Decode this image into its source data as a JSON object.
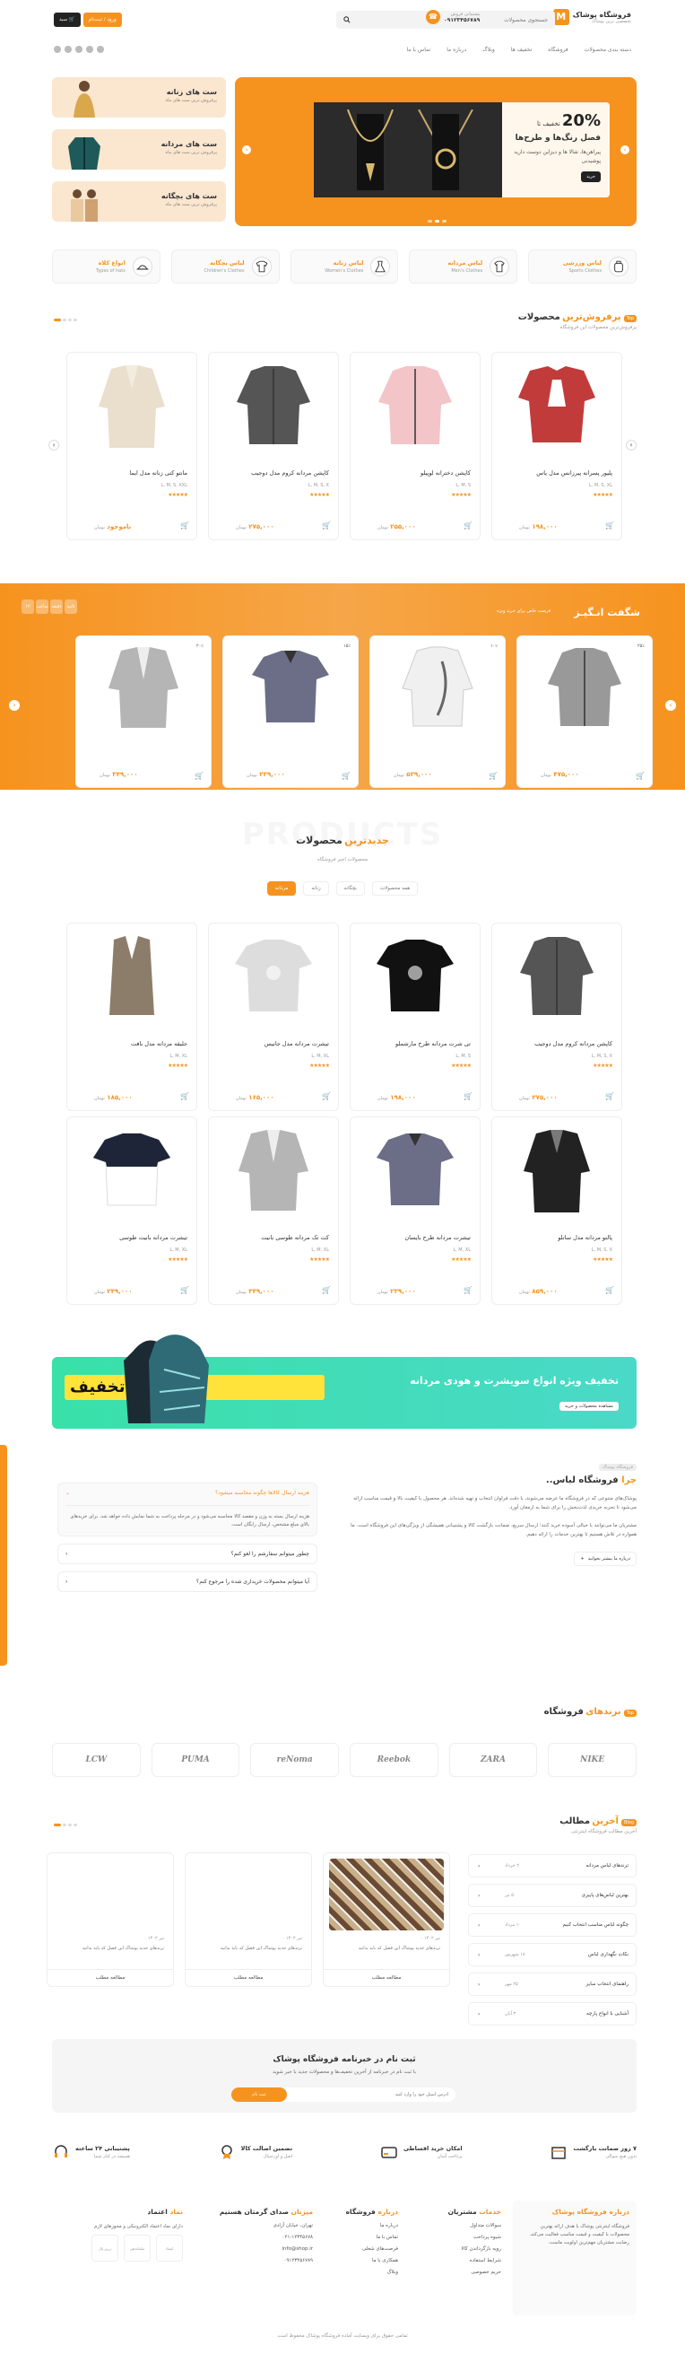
{
  "header": {
    "logo_title": "فروشگاه پوشاک",
    "logo_sub": "تخصصی ترین پوشاک",
    "search_placeholder": "جستجوی محصولات",
    "support_label": "پشتیبانی فروش",
    "support_phone": "۰۹۱۲۳۴۵۶۷۸۹",
    "login_label": "ورود / ثبت‌نام",
    "cart_label": "سبد",
    "nav": [
      "دسته بندی محصولات",
      "فروشگاه",
      "تخفیف ها",
      "وبلاگ",
      "درباره ما",
      "تماس با ما"
    ]
  },
  "hero": {
    "pct": "20%",
    "pct_pre": "تخفیف تا",
    "title": "فصل رنگ‌ها و طرح‌ها",
    "sub": "پیراهن‌ها، شالا ها و دیزاین دوست دارید پوشیدنی",
    "btn": "خرید"
  },
  "side_banners": [
    {
      "title": "ست های زنانه",
      "sub": "پرفروش ترین ست های ماه"
    },
    {
      "title": "ست های مردانه",
      "sub": "پرفروش ترین ست های ماه"
    },
    {
      "title": "ست های بچگانه",
      "sub": "پرفروش ترین ست های ماه"
    }
  ],
  "categories": [
    {
      "title": "لباس ورزشی",
      "sub": "Sports Clothes",
      "icon": "backpack-icon"
    },
    {
      "title": "لباس مردانه",
      "sub": "Men's Clothes",
      "icon": "shirt-icon"
    },
    {
      "title": "لباس زنانه",
      "sub": "Women's Clothes",
      "icon": "dress-icon"
    },
    {
      "title": "لباس بچگانه",
      "sub": "Children's Clothes",
      "icon": "tshirt-icon"
    },
    {
      "title": "انواع کلاه",
      "sub": "Types of hats",
      "icon": "hat-icon"
    }
  ],
  "bestseller": {
    "tag": "Top",
    "title_a": "پرفروش‌ترین",
    "title_b": "محصولات",
    "sub": "پرفروش‌ترین محصولات این فروشگاه",
    "items": [
      {
        "name": "پلیور پسرانه پیرزانس مدل یاس",
        "sizes": "L, M, S, XL",
        "price": "۱۹۸,۰۰۰",
        "old": "۲۳۰,۰۰۰",
        "color": "#c23b3b",
        "kind": "sweater"
      },
      {
        "name": "کاپشن دخترانه لوپیلو",
        "sizes": "L, M, S",
        "price": "۲۵۵,۰۰۰",
        "old": "",
        "color": "#f3c4c8",
        "kind": "jacket"
      },
      {
        "name": "کاپشن مردانه کروم مدل دوجیب",
        "sizes": "L, M, S, X",
        "price": "۲۷۵,۰۰۰",
        "old": "",
        "color": "#555",
        "kind": "jacket"
      },
      {
        "name": "مانتو کتی زنانه مدل ایما",
        "sizes": "L, M, S, XXL",
        "price": "ناموجود",
        "old": "",
        "color": "#eadfcc",
        "kind": "coat"
      }
    ]
  },
  "amazing": {
    "title": "شگفت انـگیـز",
    "sub": "فرصت خاص برای خرید ویژه",
    "timer": [
      "۱۲",
      "ساعت",
      "دقیقه",
      "ثانیه"
    ],
    "items": [
      {
        "price": "۴۷۵,۰۰۰",
        "color": "#999",
        "kind": "jacket",
        "badge": "۲۵٪"
      },
      {
        "price": "۵۳۹,۰۰۰",
        "color": "#f0f0f0",
        "kind": "shirt",
        "badge": "۱۰٪"
      },
      {
        "price": "۲۳۹,۰۰۰",
        "color": "#6b6e86",
        "kind": "polo",
        "badge": "۱۵٪"
      },
      {
        "price": "۳۴۹,۰۰۰",
        "color": "#b5b5b5",
        "kind": "blazer",
        "badge": "۲۰٪"
      }
    ]
  },
  "newest": {
    "bg_word": "PRODUCTS",
    "title_a": "جدیدترین",
    "title_b": "محصولات",
    "sub": "محصولات اخیر فروشگاه",
    "tabs": [
      "مردانه",
      "زنانه",
      "بچگانه",
      "همه محصولات"
    ],
    "row1": [
      {
        "name": "کاپشن مردانه کروم مدل دوجیب",
        "sizes": "L, M, S, X",
        "price": "۲۷۵,۰۰۰",
        "color": "#555",
        "kind": "jacket"
      },
      {
        "name": "تی شرت مردانه طرح مارشملو",
        "sizes": "L, M, S",
        "price": "۱۹۸,۰۰۰",
        "color": "#111",
        "kind": "tshirt"
      },
      {
        "name": "تیشرت مردانه مدل جانیس",
        "sizes": "L, M, XL",
        "price": "۱۶۵,۰۰۰",
        "color": "#ddd",
        "kind": "tshirt"
      },
      {
        "name": "جلیقه مردانه مدل بافت",
        "sizes": "L, M, XL",
        "price": "۱۸۵,۰۰۰",
        "color": "#8c7d6a",
        "kind": "vest"
      }
    ],
    "row2": [
      {
        "name": "پالتو مردانه مدل ساتلو",
        "sizes": "L, M, S, X",
        "price": "۸۵۹,۰۰۰",
        "color": "#222",
        "kind": "coat"
      },
      {
        "name": "تیشرت مردانه طرح بایسان",
        "sizes": "L, M, XL",
        "price": "۲۳۹,۰۰۰",
        "color": "#6b6e86",
        "kind": "polo"
      },
      {
        "name": "کت تک مردانه طوسی بانیت",
        "sizes": "L, M, XL",
        "price": "۳۴۹,۰۰۰",
        "color": "#b5b5b5",
        "kind": "blazer"
      },
      {
        "name": "تیشرت مردانه بانیت طوسی",
        "sizes": "L, M, XL",
        "price": "۲۴۹,۰۰۰",
        "color": "#1f2538",
        "kind": "tshirt2"
      }
    ]
  },
  "green_banner": {
    "title": "تخفیف ویژه انواع سویشرت و هودی مردانه",
    "btn": "مشاهده محصولات و خرید",
    "pct": "۲۵٪ تخفیف"
  },
  "about": {
    "tag": "فروشگاه پوشاک",
    "title_a": "چرا",
    "title_b": "فروشگاه لباس..",
    "p1": "پوشاک‌های متنوعی که در فروشگاه ما عرضه می‌شوند، با دقت فراوان انتخاب و تهیه شده‌اند. هر محصول با کیفیت بالا و قیمت مناسب ارائه می‌شود تا تجربه خریدی لذت‌بخش را برای شما به ارمغان آورد.",
    "p2": "مشتریان ما می‌توانند با خیالی آسوده خرید کنند؛ ارسال سریع، ضمانت بازگشت کالا و پشتیبانی همیشگی از ویژگی‌های این فروشگاه است. ما همواره در تلاش هستیم تا بهترین خدمات را ارائه دهیم.",
    "btn": "درباره ما بیشتر بخوانید"
  },
  "faq": [
    {
      "q": "هزینه ارسال کالاها چگونه محاسبه میشود؟",
      "a": "هزینه ارسال بسته به وزن و مقصد کالا محاسبه می‌شود و در مرحله پرداخت به شما نمایش داده خواهد شد. برای خریدهای بالای مبلغ مشخص، ارسال رایگان است."
    },
    {
      "q": "چطور میتوانم سفارشم را لغو کنم؟",
      "a": ""
    },
    {
      "q": "آیا میتوانم محصولات خریداری شده را مرجوع کنم؟",
      "a": ""
    }
  ],
  "brands": {
    "title_a": "برندهای",
    "title_b": "فروشگاه",
    "tag": "Top",
    "items": [
      "NIKE",
      "ZARA",
      "Reebok",
      "reNoma",
      "PUMA",
      "LCW"
    ]
  },
  "blog": {
    "tag": "Blog",
    "title_a": "آخرین",
    "title_b": "مطالب",
    "sub": "آخرین مطالب فروشگاه اینترنتی",
    "list": [
      {
        "t": "ترندهای لباس مردانه",
        "d": "۲ خرداد"
      },
      {
        "t": "بهترین لباس‌های پاییزی",
        "d": "۵ تیر"
      },
      {
        "t": "چگونه لباس مناسب انتخاب کنیم",
        "d": "۱۰ مرداد"
      },
      {
        "t": "نکات نگهداری لباس",
        "d": "۱۸ شهریور"
      },
      {
        "t": "راهنمای انتخاب سایز",
        "d": "۲۵ مهر"
      },
      {
        "t": "آشنایی با انواع پارچه",
        "d": "۳ آبان"
      }
    ],
    "cards": [
      {
        "meta": "تیر ۱۴۰۲ ۰",
        "text": "ترندهای جدید پوشاک این فصل که باید بدانید",
        "more": "مطالعه مطلب"
      },
      {
        "meta": "تیر ۱۴۰۲ ۰",
        "text": "ترندهای جدید پوشاک این فصل که باید بدانید",
        "more": "مطالعه مطلب"
      },
      {
        "meta": "تیر ۱۴۰۲ ۰",
        "text": "ترندهای جدید پوشاک این فصل که باید بدانید",
        "more": "مطالعه مطلب"
      }
    ]
  },
  "newsletter": {
    "title": "ثبت نام در خبرنامه فروشگاه پوشاک",
    "sub": "با ثبت نام در خبرنامه از آخرین تخفیف‌ها و محصولات جدید با خبر شوید",
    "placeholder": "آدرس ایمیل خود را وارد کنید",
    "btn": "ثبت نام"
  },
  "services": [
    {
      "t": "۷ روز ضمانت بازگشت",
      "s": "بدون هیچ سوالی"
    },
    {
      "t": "امکان خرید اقساطی",
      "s": "پرداخت آسان"
    },
    {
      "t": "تضمین اصالت کالا",
      "s": "اصل و اورجینال"
    },
    {
      "t": "پشتیبانی ۲۴ ساعته",
      "s": "همیشه در کنار شما"
    }
  ],
  "footer": {
    "about_title_a": "درباره",
    "about_title_b": "فروشگاه پوشاک",
    "about_text": "فروشگاه اینترنتی پوشاک با هدف ارائه بهترین محصولات با کیفیت و قیمت مناسب فعالیت می‌کند. رضایت مشتریان مهم‌ترین اولویت ماست.",
    "col1_title_a": "خدمات",
    "col1_title_b": "مشتریان",
    "col1": [
      "سوالات متداول",
      "شیوه پرداخت",
      "رویه بازگرداندن کالا",
      "شرایط استفاده",
      "حریم خصوصی"
    ],
    "col2_title_a": "درباره",
    "col2_title_b": "فروشگاه",
    "col2": [
      "درباره ما",
      "تماس با ما",
      "فرصت‌های شغلی",
      "همکاری با ما",
      "وبلاگ"
    ],
    "col3_title_a": "میزبان",
    "col3_title_b": "صدای گرمتان هستیم",
    "col3": [
      "تهران، خیابان آزادی",
      "۰۲۱-۱۲۳۴۵۶۷۸",
      "info@shop.ir",
      "۰۹۱۲۳۴۵۶۷۸۹"
    ],
    "col4_title_a": "نماد",
    "col4_title_b": "اعتماد",
    "col4_text": "دارای نماد اعتماد الکترونیکی و مجوزهای لازم",
    "trust": [
      "اینماد",
      "ساماندهی",
      "زرین پال"
    ],
    "copyright": "تمامی حقوق برای وبسایت آماده فروشگاه پوشاک محفوظ است"
  }
}
